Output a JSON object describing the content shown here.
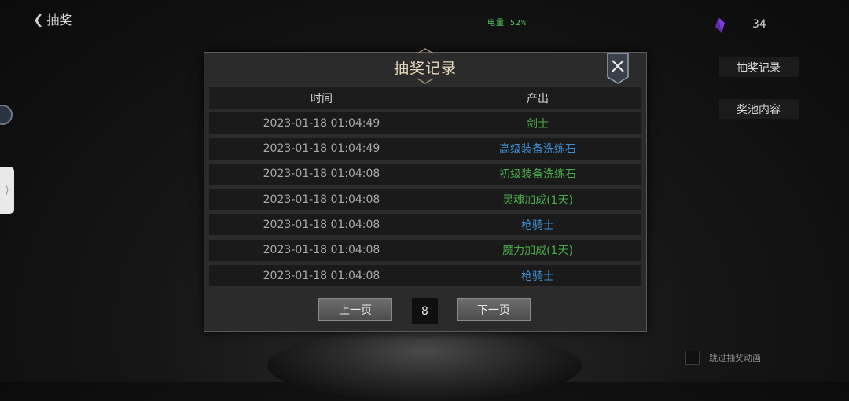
{
  "topbar": {
    "back_label": "抽奖",
    "battery": "电量 52%",
    "gem_count": "34"
  },
  "side": {
    "history_button": "抽奖记录",
    "pool_button": "奖池内容",
    "skip_label": "跳过抽奖动画"
  },
  "modal": {
    "title": "抽奖记录",
    "columns": {
      "time": "时间",
      "output": "产出"
    },
    "rows": [
      {
        "time": "2023-01-18 01:04:49",
        "item": "剑士"
      },
      {
        "time": "2023-01-18 01:04:49",
        "item": "高级装备洗练石"
      },
      {
        "time": "2023-01-18 01:04:08",
        "item": "初级装备洗练石"
      },
      {
        "time": "2023-01-18 01:04:08",
        "item": "灵魂加成(1天)"
      },
      {
        "time": "2023-01-18 01:04:08",
        "item": "枪骑士"
      },
      {
        "time": "2023-01-18 01:04:08",
        "item": "魔力加成(1天)"
      },
      {
        "time": "2023-01-18 01:04:08",
        "item": "枪骑士"
      }
    ],
    "prev_label": "上一页",
    "next_label": "下一页",
    "page": "8"
  },
  "colors": {
    "green_item": "#4aaa4a",
    "blue_item": "#3f8fd6",
    "title": "#e4d6bb",
    "battery": "#4fd06a"
  }
}
